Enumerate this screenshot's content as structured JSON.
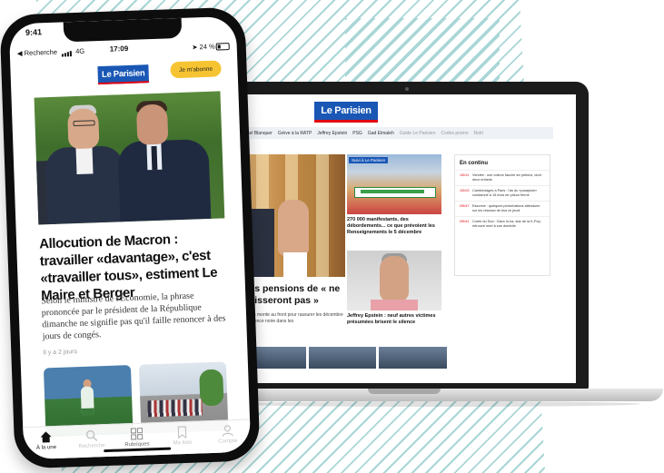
{
  "phone": {
    "status": {
      "time_top": "9:41",
      "back_label": "◀ Recherche",
      "network": "4G",
      "clock": "17:09",
      "battery": "24 %"
    },
    "brand": {
      "logo": "Le Parisien",
      "subscribe_label": "Je m'abonne",
      "accent": "#1a57b5",
      "subscribe_color": "#f6c432"
    },
    "article": {
      "headline": "Allocution de Macron : travailler «davantage», c'est «travailler tous», estiment Le Maire et Berger",
      "summary": "Selon le ministre de l'Économie, la phrase prononcée par le président de la République dimanche ne signifie pas qu'il faille renoncer à des jours de congés.",
      "time_ago": "Il y a 2 jours"
    },
    "tabbar": [
      {
        "label": "À la une",
        "icon": "home-icon",
        "active": true
      },
      {
        "label": "Recherche",
        "icon": "search-icon",
        "active": false
      },
      {
        "label": "Rubriques",
        "icon": "grid-icon",
        "active": false
      },
      {
        "label": "Ma liste",
        "icon": "bookmark-icon",
        "active": false
      },
      {
        "label": "Compte",
        "icon": "user-icon",
        "active": false
      }
    ]
  },
  "laptop": {
    "logo": "Le Parisien",
    "nav": [
      "Michel Blanquer",
      "Grève à la RATP",
      "Jeffrey Epstein",
      "PSG",
      "Gad Elmaleh",
      "Guide Le Parisien",
      "Codes promo",
      "Noël"
    ],
    "hero": {
      "title": "Les pensions de « ne baisseront pas »",
      "text": "risque monte au front pour rassurer les décembre s'annonce noire dans les"
    },
    "cards": [
      {
        "tag": "Suivi à Le Parisien",
        "title": "270 000 manifestants, des débordements... ce que prévoient les Renseignements le 5 décembre"
      },
      {
        "tag": "",
        "title": "Jeffrey Epstein : neuf autres victimes présumées brisent le silence"
      }
    ],
    "sidebar": {
      "title": "En continu",
      "items": [
        {
          "time": "10h11",
          "text": "Vendée : une voiture fauche six piétons, dont deux enfants"
        },
        {
          "time": "10h02",
          "text": "Cambriolages à Paris : l'as du «parapluie» condamné à 15 mois de prison ferme"
        },
        {
          "time": "09h47",
          "text": "Essonne : quelques perturbations attendues sur les réseaux de bus ce jeudi"
        },
        {
          "time": "09h41",
          "text": "Corée du Sud : Clara In-ha, star de la K-Pop, retrouvé mort à son domicile"
        }
      ]
    }
  }
}
